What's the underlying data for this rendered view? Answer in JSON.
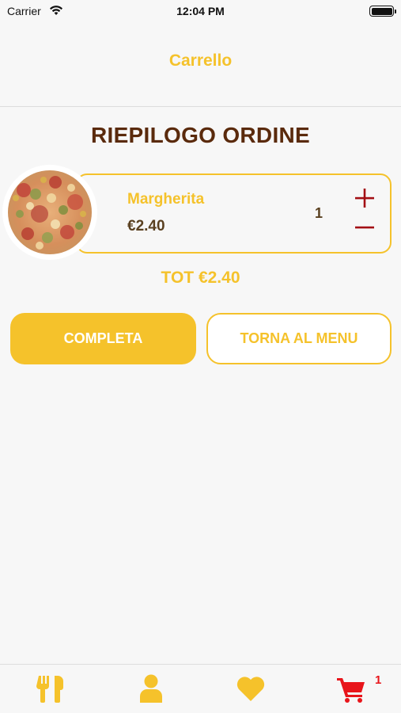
{
  "status_bar": {
    "carrier": "Carrier",
    "time": "12:04 PM"
  },
  "nav": {
    "title": "Carrello"
  },
  "summary": {
    "title": "RIEPILOGO ORDINE"
  },
  "order_items": [
    {
      "name": "Margherita",
      "price": "€2.40",
      "quantity": "1"
    }
  ],
  "total": "TOT €2.40",
  "actions": {
    "complete_label": "COMPLETA",
    "back_label": "TORNA AL MENU"
  },
  "tab_bar": {
    "tabs": [
      {
        "icon": "fork-knife-icon"
      },
      {
        "icon": "user-icon"
      },
      {
        "icon": "heart-icon"
      },
      {
        "icon": "cart-icon"
      }
    ],
    "cart_badge": "1"
  },
  "colors": {
    "accent": "#f5c22b",
    "title_brown": "#5a2a0c",
    "danger": "#e8151b",
    "stepper": "#a30f14"
  }
}
